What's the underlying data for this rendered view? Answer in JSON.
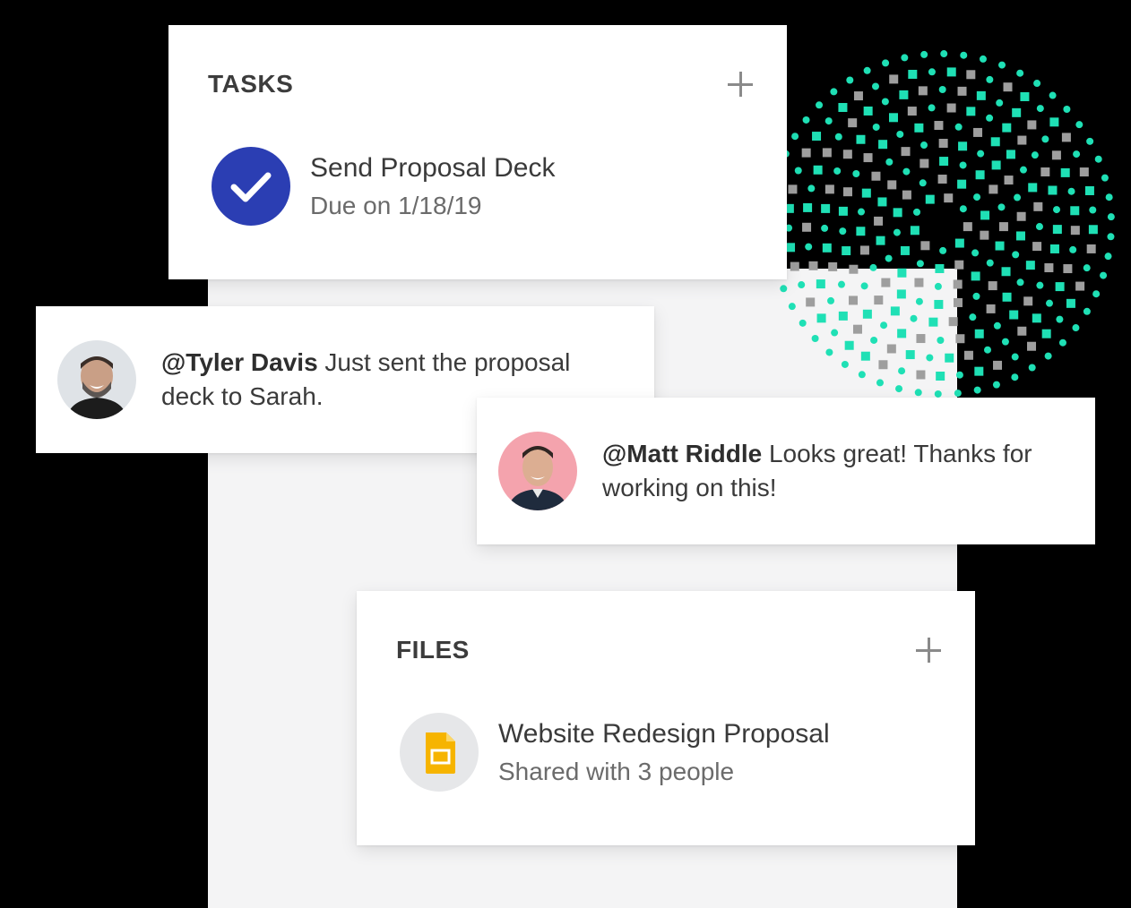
{
  "tasks": {
    "header": "TASKS",
    "add_icon": "plus-icon",
    "item": {
      "title": "Send Proposal Deck",
      "subtitle": "Due on 1/18/19",
      "icon": "check-circle-icon",
      "icon_color": "#2b3eb3"
    }
  },
  "comments": [
    {
      "mention": "@Tyler Davis",
      "text": " Just sent the proposal deck to Sarah.",
      "avatar": "avatar-tyler-davis"
    },
    {
      "mention": "@Matt Riddle",
      "text": " Looks great! Thanks for working on this!",
      "avatar": "avatar-matt-riddle",
      "avatar_bg": "#f4a3ad"
    }
  ],
  "files": {
    "header": "FILES",
    "add_icon": "plus-icon",
    "item": {
      "title": "Website Redesign Proposal",
      "subtitle": "Shared with 3 people",
      "icon": "google-slides-icon",
      "icon_color": "#f6b400"
    }
  },
  "decor": {
    "dot_color": "#1fe0b5",
    "square_color": "#9e9e9e"
  }
}
